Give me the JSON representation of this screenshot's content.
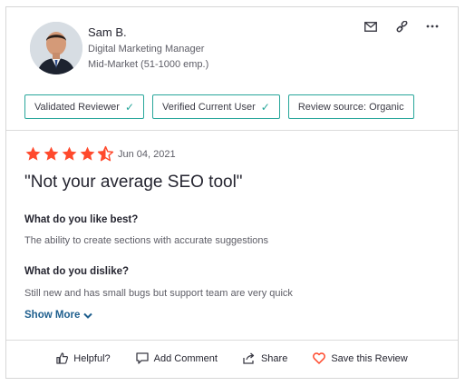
{
  "reviewer": {
    "name": "Sam B.",
    "job_title": "Digital Marketing Manager",
    "company_size": "Mid-Market (51-1000 emp.)"
  },
  "badges": [
    {
      "label": "Validated Reviewer",
      "check": "✓"
    },
    {
      "label": "Verified Current User",
      "check": "✓"
    },
    {
      "label": "Review source: Organic",
      "check": ""
    }
  ],
  "review": {
    "rating": 4.5,
    "date": "Jun 04, 2021",
    "title": "\"Not your average SEO tool\"",
    "like_question": "What do you like best?",
    "like_answer": "The ability to create sections with accurate suggestions",
    "dislike_question": "What do you dislike?",
    "dislike_answer": "Still new and has small bugs but support team are very quick",
    "show_more": "Show More"
  },
  "footer": {
    "helpful": "Helpful?",
    "add_comment": "Add Comment",
    "share": "Share",
    "save": "Save this Review"
  },
  "colors": {
    "star": "#ff492c",
    "badge_border": "#27a69a",
    "link": "#1f5f8e",
    "heart": "#ff492c"
  }
}
